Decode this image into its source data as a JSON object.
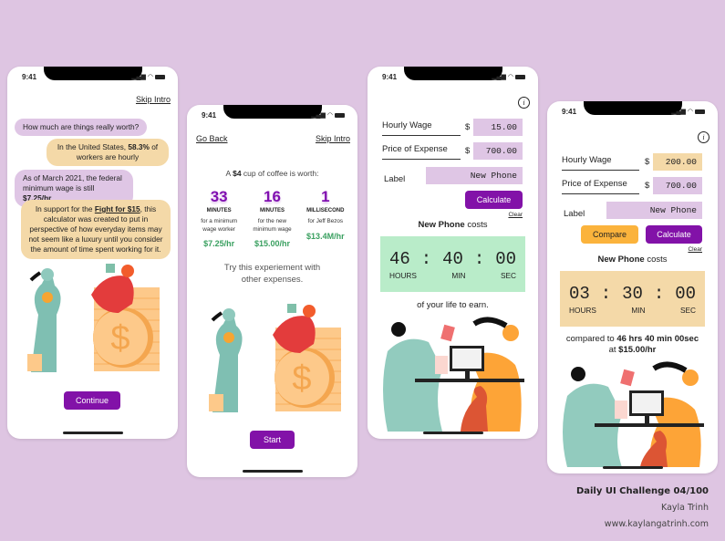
{
  "status_bar": {
    "time": "9:41"
  },
  "screen1": {
    "skip_intro": "Skip Intro",
    "bubbles": [
      {
        "text": "How much are things really worth?"
      },
      {
        "pre": "In the United States, ",
        "bold": "58.3%",
        "post": " of workers are hourly"
      },
      {
        "pre": "As of March 2021, the federal minimum wage is still ",
        "bold": "$7.25/hr",
        "post": ""
      },
      {
        "pre": "In support for the ",
        "bold": "Fight for $15",
        "post": ", this calculator was created to put in perspective of how everyday items may not seem like a luxury until you consider the amount of time spent working for it."
      }
    ],
    "continue_label": "Continue"
  },
  "screen2": {
    "go_back": "Go Back",
    "skip_intro": "Skip Intro",
    "headline_pre": "A ",
    "headline_bold": "$4",
    "headline_post": " cup of coffee is worth:",
    "stats": [
      {
        "value": "33",
        "unit": "MINUTES",
        "desc": "for a minimum wage worker",
        "rate": "$7.25/hr"
      },
      {
        "value": "16",
        "unit": "MINUTES",
        "desc": "for the new minimum wage",
        "rate": "$15.00/hr"
      },
      {
        "value": "1",
        "unit": "MILLISECOND",
        "desc": "for Jeff Bezos",
        "rate": "$13.4M/hr"
      }
    ],
    "try_text": "Try this experiement with other expenses.",
    "start_label": "Start"
  },
  "screen3": {
    "hourly_wage_label": "Hourly Wage",
    "hourly_wage_value": "15.00",
    "price_label": "Price of Expense",
    "price_value": "700.00",
    "currency": "$",
    "label_label": "Label",
    "label_value": "New Phone",
    "calculate_label": "Calculate",
    "clear_label": "Clear",
    "result_bold": "New Phone",
    "result_post": " costs",
    "timer": {
      "hours": "46",
      "min": "40",
      "sec": "00",
      "sep": ":",
      "hours_label": "HOURS",
      "min_label": "MIN",
      "sec_label": "SEC"
    },
    "footer": "of your life to earn."
  },
  "screen4": {
    "hourly_wage_label": "Hourly Wage",
    "hourly_wage_value": "200.00",
    "price_label": "Price of Expense",
    "price_value": "700.00",
    "currency": "$",
    "label_label": "Label",
    "label_value": "New Phone",
    "compare_label": "Compare",
    "calculate_label": "Calculate",
    "clear_label": "Clear",
    "result_bold": "New Phone",
    "result_post": " costs",
    "timer": {
      "hours": "03",
      "min": "30",
      "sec": "00",
      "sep": ":",
      "hours_label": "HOURS",
      "min_label": "MIN",
      "sec_label": "SEC"
    },
    "compare_pre": "compared to ",
    "compare_bold": "46 hrs 40 min 00sec",
    "compare_mid": "at ",
    "compare_rate": "$15.00/hr"
  },
  "credits": {
    "title": "Daily UI Challenge 04/100",
    "author": "Kayla Trinh",
    "website": "www.kaylangatrinh.com"
  },
  "colors": {
    "accent_purple": "#8212a8",
    "bubble_purple": "#dfc6e5",
    "bubble_tan": "#f4d9a8",
    "timer_green": "#b9ecc9",
    "timer_tan": "#f4d9a8",
    "rate_green": "#3aa060",
    "compare_orange": "#fbb33c",
    "background": "#dec5e2"
  }
}
